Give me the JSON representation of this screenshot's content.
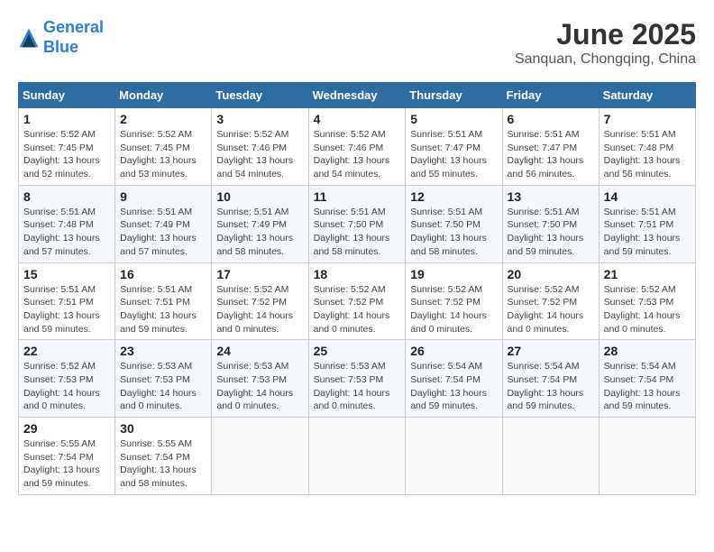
{
  "header": {
    "logo_line1": "General",
    "logo_line2": "Blue",
    "month_title": "June 2025",
    "location": "Sanquan, Chongqing, China"
  },
  "weekdays": [
    "Sunday",
    "Monday",
    "Tuesday",
    "Wednesday",
    "Thursday",
    "Friday",
    "Saturday"
  ],
  "weeks": [
    [
      {
        "day": "1",
        "sunrise": "5:52 AM",
        "sunset": "7:45 PM",
        "daylight": "13 hours and 52 minutes."
      },
      {
        "day": "2",
        "sunrise": "5:52 AM",
        "sunset": "7:45 PM",
        "daylight": "13 hours and 53 minutes."
      },
      {
        "day": "3",
        "sunrise": "5:52 AM",
        "sunset": "7:46 PM",
        "daylight": "13 hours and 54 minutes."
      },
      {
        "day": "4",
        "sunrise": "5:52 AM",
        "sunset": "7:46 PM",
        "daylight": "13 hours and 54 minutes."
      },
      {
        "day": "5",
        "sunrise": "5:51 AM",
        "sunset": "7:47 PM",
        "daylight": "13 hours and 55 minutes."
      },
      {
        "day": "6",
        "sunrise": "5:51 AM",
        "sunset": "7:47 PM",
        "daylight": "13 hours and 56 minutes."
      },
      {
        "day": "7",
        "sunrise": "5:51 AM",
        "sunset": "7:48 PM",
        "daylight": "13 hours and 56 minutes."
      }
    ],
    [
      {
        "day": "8",
        "sunrise": "5:51 AM",
        "sunset": "7:48 PM",
        "daylight": "13 hours and 57 minutes."
      },
      {
        "day": "9",
        "sunrise": "5:51 AM",
        "sunset": "7:49 PM",
        "daylight": "13 hours and 57 minutes."
      },
      {
        "day": "10",
        "sunrise": "5:51 AM",
        "sunset": "7:49 PM",
        "daylight": "13 hours and 58 minutes."
      },
      {
        "day": "11",
        "sunrise": "5:51 AM",
        "sunset": "7:50 PM",
        "daylight": "13 hours and 58 minutes."
      },
      {
        "day": "12",
        "sunrise": "5:51 AM",
        "sunset": "7:50 PM",
        "daylight": "13 hours and 58 minutes."
      },
      {
        "day": "13",
        "sunrise": "5:51 AM",
        "sunset": "7:50 PM",
        "daylight": "13 hours and 59 minutes."
      },
      {
        "day": "14",
        "sunrise": "5:51 AM",
        "sunset": "7:51 PM",
        "daylight": "13 hours and 59 minutes."
      }
    ],
    [
      {
        "day": "15",
        "sunrise": "5:51 AM",
        "sunset": "7:51 PM",
        "daylight": "13 hours and 59 minutes."
      },
      {
        "day": "16",
        "sunrise": "5:51 AM",
        "sunset": "7:51 PM",
        "daylight": "13 hours and 59 minutes."
      },
      {
        "day": "17",
        "sunrise": "5:52 AM",
        "sunset": "7:52 PM",
        "daylight": "14 hours and 0 minutes."
      },
      {
        "day": "18",
        "sunrise": "5:52 AM",
        "sunset": "7:52 PM",
        "daylight": "14 hours and 0 minutes."
      },
      {
        "day": "19",
        "sunrise": "5:52 AM",
        "sunset": "7:52 PM",
        "daylight": "14 hours and 0 minutes."
      },
      {
        "day": "20",
        "sunrise": "5:52 AM",
        "sunset": "7:52 PM",
        "daylight": "14 hours and 0 minutes."
      },
      {
        "day": "21",
        "sunrise": "5:52 AM",
        "sunset": "7:53 PM",
        "daylight": "14 hours and 0 minutes."
      }
    ],
    [
      {
        "day": "22",
        "sunrise": "5:52 AM",
        "sunset": "7:53 PM",
        "daylight": "14 hours and 0 minutes."
      },
      {
        "day": "23",
        "sunrise": "5:53 AM",
        "sunset": "7:53 PM",
        "daylight": "14 hours and 0 minutes."
      },
      {
        "day": "24",
        "sunrise": "5:53 AM",
        "sunset": "7:53 PM",
        "daylight": "14 hours and 0 minutes."
      },
      {
        "day": "25",
        "sunrise": "5:53 AM",
        "sunset": "7:53 PM",
        "daylight": "14 hours and 0 minutes."
      },
      {
        "day": "26",
        "sunrise": "5:54 AM",
        "sunset": "7:54 PM",
        "daylight": "13 hours and 59 minutes."
      },
      {
        "day": "27",
        "sunrise": "5:54 AM",
        "sunset": "7:54 PM",
        "daylight": "13 hours and 59 minutes."
      },
      {
        "day": "28",
        "sunrise": "5:54 AM",
        "sunset": "7:54 PM",
        "daylight": "13 hours and 59 minutes."
      }
    ],
    [
      {
        "day": "29",
        "sunrise": "5:55 AM",
        "sunset": "7:54 PM",
        "daylight": "13 hours and 59 minutes."
      },
      {
        "day": "30",
        "sunrise": "5:55 AM",
        "sunset": "7:54 PM",
        "daylight": "13 hours and 58 minutes."
      },
      null,
      null,
      null,
      null,
      null
    ]
  ]
}
